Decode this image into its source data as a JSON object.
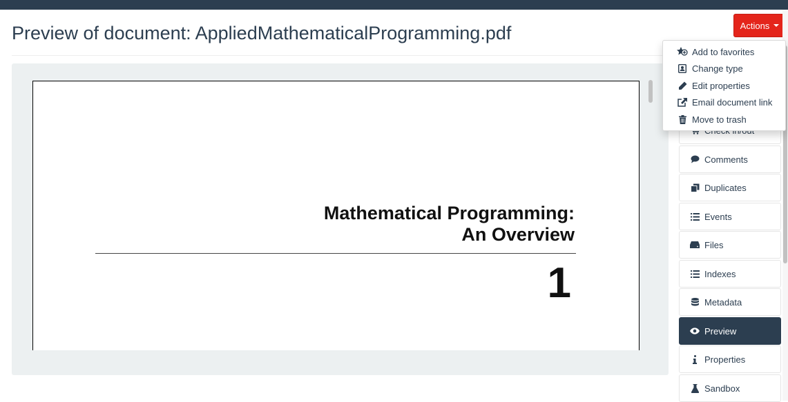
{
  "page": {
    "title": "Preview of document: AppliedMathematicalProgramming.pdf"
  },
  "actions": {
    "label": "Actions",
    "menu": [
      {
        "label": "Add to favorites",
        "icon": "star-plus-icon"
      },
      {
        "label": "Change type",
        "icon": "id-card-icon"
      },
      {
        "label": "Edit properties",
        "icon": "pencil-icon"
      },
      {
        "label": "Email document link",
        "icon": "external-link-icon"
      },
      {
        "label": "Move to trash",
        "icon": "trash-icon"
      }
    ]
  },
  "document_preview": {
    "heading_line1": "Mathematical Programming:",
    "heading_line2": "An Overview",
    "chapter_number": "1"
  },
  "sidebar": {
    "items": [
      {
        "label": "Check in/out",
        "icon": "cart-icon"
      },
      {
        "label": "Comments",
        "icon": "comment-icon"
      },
      {
        "label": "Duplicates",
        "icon": "copy-icon"
      },
      {
        "label": "Events",
        "icon": "list-icon"
      },
      {
        "label": "Files",
        "icon": "hdd-icon"
      },
      {
        "label": "Indexes",
        "icon": "list-icon"
      },
      {
        "label": "Metadata",
        "icon": "database-icon"
      },
      {
        "label": "Preview",
        "icon": "eye-icon",
        "active": true
      },
      {
        "label": "Properties",
        "icon": "info-icon"
      },
      {
        "label": "Sandbox",
        "icon": "flask-icon"
      }
    ]
  },
  "colors": {
    "navbar": "#2c3e50",
    "actions_button": "#e4251b",
    "active_item": "#2c3e50",
    "well": "#ecf0f1"
  }
}
